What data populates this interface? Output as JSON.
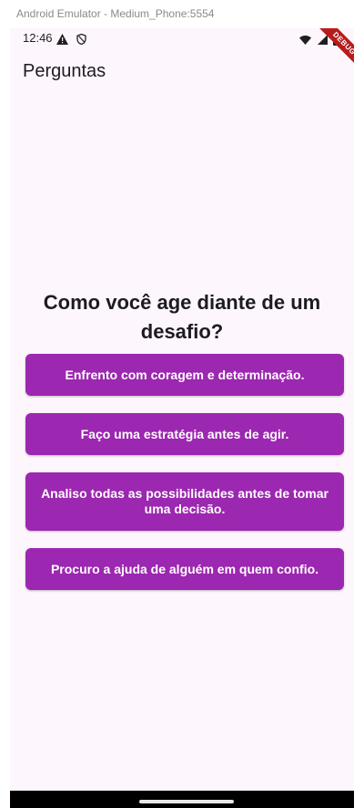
{
  "emulator": {
    "window_title": "Android Emulator - Medium_Phone:5554"
  },
  "status_bar": {
    "time": "12:46",
    "left_icons": [
      "warning-icon",
      "shield-icon"
    ],
    "right_icons": [
      "wifi-icon",
      "signal-icon",
      "battery-icon"
    ]
  },
  "debug_banner": {
    "label": "DEBUG"
  },
  "app_bar": {
    "title": "Perguntas"
  },
  "quiz": {
    "question": "Como você age diante de um desafio?",
    "answers": [
      "Enfrento com coragem e determinação.",
      "Faço uma estratégia antes de agir.",
      "Analiso todas as possibilidades antes de tomar uma decisão.",
      "Procuro a ajuda de alguém em quem confio."
    ]
  },
  "colors": {
    "background": "#fdf6fd",
    "button": "#9c27b0",
    "button_text": "#ffffff",
    "debug_banner": "#b71c1c"
  }
}
